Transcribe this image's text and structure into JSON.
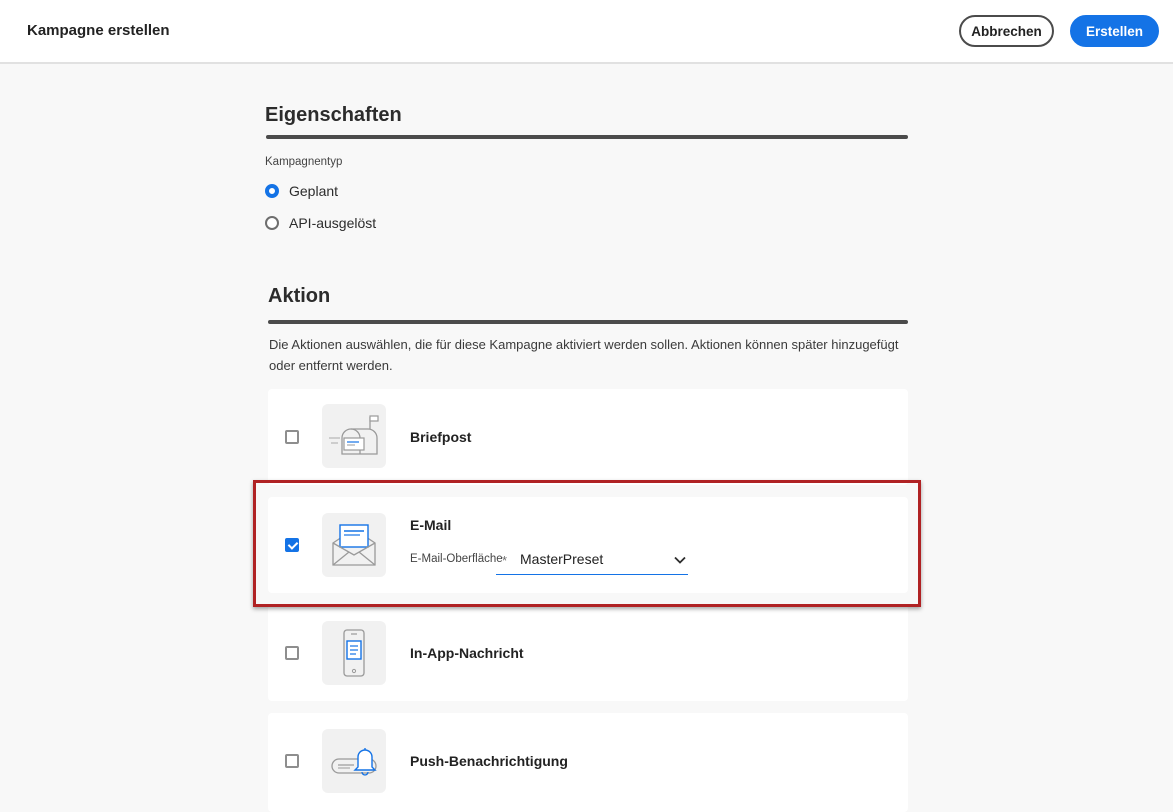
{
  "header": {
    "title": "Kampagne erstellen",
    "cancel_label": "Abbrechen",
    "create_label": "Erstellen"
  },
  "properties": {
    "title": "Eigenschaften",
    "campaign_type_label": "Kampagnentyp",
    "options": [
      {
        "label": "Geplant",
        "selected": true
      },
      {
        "label": "API-ausgelöst",
        "selected": false
      }
    ]
  },
  "action": {
    "title": "Aktion",
    "description": "Die Aktionen auswählen, die für diese Kampagne aktiviert werden sollen. Aktionen können später hinzugefügt oder entfernt werden.",
    "items": [
      {
        "label": "Briefpost",
        "checked": false,
        "icon": "mailbox-icon"
      },
      {
        "label": "E-Mail",
        "checked": true,
        "icon": "envelope-icon",
        "surface_label": "E-Mail-Oberfläche",
        "required_mark": "*",
        "surface_value": "MasterPreset"
      },
      {
        "label": "In-App-Nachricht",
        "checked": false,
        "icon": "mobile-message-icon"
      },
      {
        "label": "Push-Benachrichtigung",
        "checked": false,
        "icon": "bell-icon"
      }
    ]
  },
  "colors": {
    "accent": "#1473e6",
    "highlight": "#b02224"
  }
}
